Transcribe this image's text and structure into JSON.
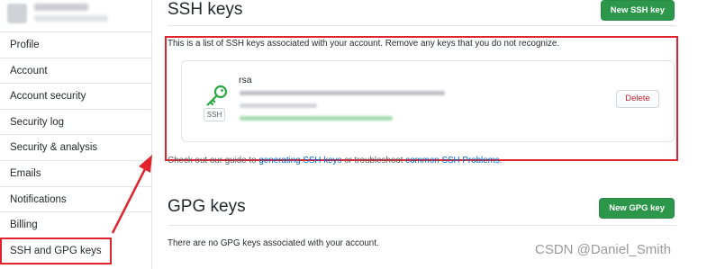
{
  "sidebar": {
    "items": [
      {
        "label": "Profile"
      },
      {
        "label": "Account"
      },
      {
        "label": "Account security"
      },
      {
        "label": "Security log"
      },
      {
        "label": "Security & analysis"
      },
      {
        "label": "Emails"
      },
      {
        "label": "Notifications"
      },
      {
        "label": "Billing"
      },
      {
        "label": "SSH and GPG keys",
        "selected": true
      }
    ]
  },
  "ssh": {
    "title": "SSH keys",
    "new_button": "New SSH key",
    "intro": "This is a list of SSH keys associated with your account. Remove any keys that you do not recognize.",
    "key": {
      "title": "rsa",
      "badge": "SSH",
      "delete_label": "Delete"
    },
    "guide_prefix": "Check out our guide to ",
    "guide_link1": "generating SSH keys",
    "guide_middle": " or troubleshoot ",
    "guide_link2": "common SSH Problems",
    "guide_suffix": "."
  },
  "gpg": {
    "title": "GPG keys",
    "new_button": "New GPG key",
    "empty": "There are no GPG keys associated with your account."
  },
  "watermark": "CSDN @Daniel_Smith",
  "colors": {
    "accent_red": "#e0232d",
    "primary_green": "#2c974b",
    "link_blue": "#0366d6",
    "key_green": "#28a745"
  },
  "icons": {
    "key": "key-icon",
    "arrow": "annotation-arrow"
  }
}
